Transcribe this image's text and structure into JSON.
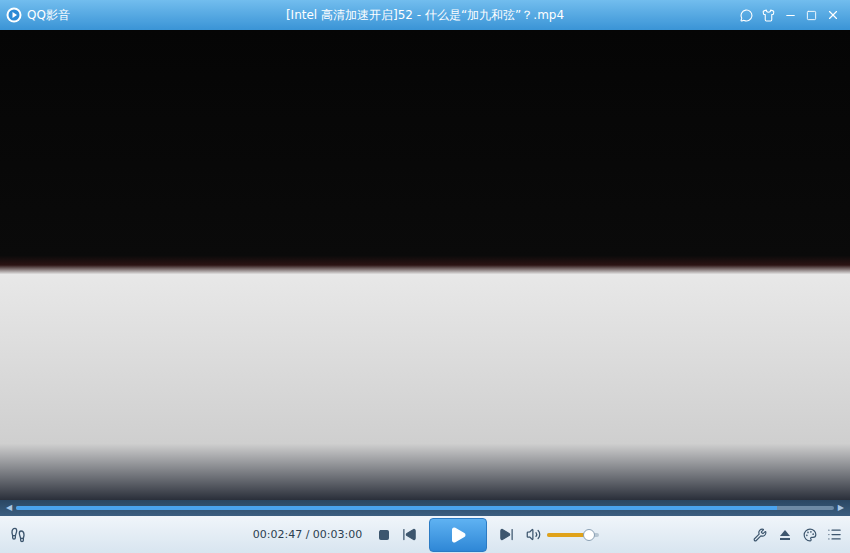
{
  "window": {
    "app_name": "QQ影音",
    "title": "[Intel 高清加速开启]52 - 什么是“加九和弦”？.mp4"
  },
  "progress": {
    "level": 0.93
  },
  "controls": {
    "time": "00:02:47 / 00:03:00",
    "playing": false,
    "volume": {
      "level": 0.8,
      "muted": false
    }
  }
}
